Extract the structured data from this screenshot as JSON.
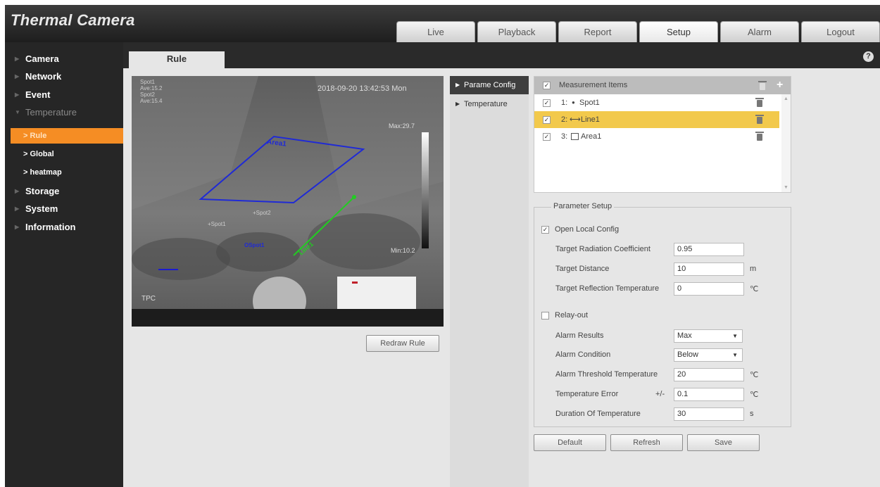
{
  "app": {
    "title": "Thermal Camera"
  },
  "nav": {
    "tabs": [
      "Live",
      "Playback",
      "Report",
      "Setup",
      "Alarm",
      "Logout"
    ],
    "active": "Setup"
  },
  "sidebar": {
    "items": [
      {
        "label": "Camera"
      },
      {
        "label": "Network"
      },
      {
        "label": "Event"
      },
      {
        "label": "Temperature"
      },
      {
        "label": "Storage"
      },
      {
        "label": "System"
      },
      {
        "label": "Information"
      }
    ],
    "sub_items": [
      {
        "label": "> Rule"
      },
      {
        "label": "> Global"
      },
      {
        "label": "> heatmap"
      }
    ]
  },
  "page": {
    "tab": "Rule",
    "help_icon": "help-icon"
  },
  "video": {
    "timestamp": "2018-09-20 13:42:53 Mon",
    "info_lines": [
      "Spot1",
      "Ave:15.2",
      "Spot2",
      "Ave:15.4"
    ],
    "max_label": "Max:29.7",
    "min_label": "Min:10.2",
    "channel_label": "TPC",
    "overlays": {
      "area": "Area1",
      "line": "Line1",
      "spot1": "+Spot1",
      "spot2": "+Spot2",
      "spot_o": "OSpot1"
    }
  },
  "buttons": {
    "redraw": "Redraw Rule",
    "default": "Default",
    "refresh": "Refresh",
    "save": "Save"
  },
  "config_nav": {
    "items": [
      "Parame Config",
      "Temperature"
    ],
    "active": "Parame Config"
  },
  "measurement": {
    "header": "Measurement Items",
    "rows": [
      {
        "index": "1:",
        "icon": "spot-icon",
        "label": "Spot1",
        "checked": true
      },
      {
        "index": "2:",
        "icon": "line-icon",
        "label": "Line1",
        "checked": true,
        "selected": true
      },
      {
        "index": "3:",
        "icon": "area-icon",
        "label": "Area1",
        "checked": true
      }
    ]
  },
  "params": {
    "title": "Parameter Setup",
    "open_local": "Open Local Config",
    "open_local_checked": true,
    "radiation_label": "Target Radiation Coefficient",
    "radiation_value": "0.95",
    "distance_label": "Target Distance",
    "distance_value": "10",
    "distance_unit": "m",
    "reflection_label": "Target Reflection Temperature",
    "reflection_value": "0",
    "reflection_unit": "℃",
    "relay_label": "Relay-out",
    "relay_checked": false,
    "alarm_results_label": "Alarm Results",
    "alarm_results_value": "Max",
    "alarm_condition_label": "Alarm Condition",
    "alarm_condition_value": "Below",
    "threshold_label": "Alarm Threshold Temperature",
    "threshold_value": "20",
    "threshold_unit": "℃",
    "error_label": "Temperature Error",
    "error_sign": "+/-",
    "error_value": "0.1",
    "error_unit": "℃",
    "duration_label": "Duration Of Temperature",
    "duration_value": "30",
    "duration_unit": "s"
  },
  "colors": {
    "accent": "#f58d24",
    "selected_row": "#f2c94c",
    "area": "#1f2ad6",
    "line": "#22cc22"
  }
}
